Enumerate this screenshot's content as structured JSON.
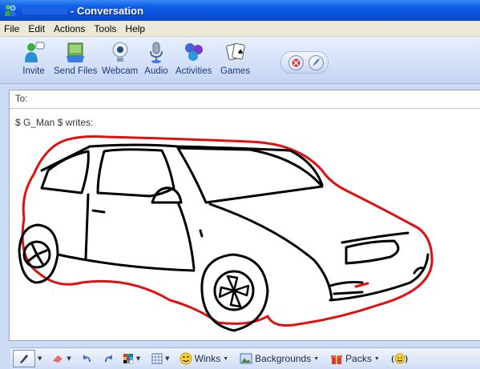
{
  "window": {
    "title": "- Conversation"
  },
  "menu": [
    "File",
    "Edit",
    "Actions",
    "Tools",
    "Help"
  ],
  "toolbar": {
    "items": [
      {
        "label": "Invite",
        "icon": "invite-icon"
      },
      {
        "label": "Send Files",
        "icon": "send-files-icon"
      },
      {
        "label": "Webcam",
        "icon": "webcam-icon"
      },
      {
        "label": "Audio",
        "icon": "microphone-icon"
      },
      {
        "label": "Activities",
        "icon": "activities-icon"
      },
      {
        "label": "Games",
        "icon": "games-icon"
      }
    ],
    "extra_buttons": [
      "block-icon",
      "feather-icon"
    ]
  },
  "conversation": {
    "to_label": "To:",
    "message_header": "$ G_Man $ writes:",
    "content": "handwritten drawing of a car"
  },
  "bottom_toolbar": {
    "winks": "Winks",
    "backgrounds": "Backgrounds",
    "packs": "Packs"
  },
  "colors": {
    "title_bar": "#0a48c8",
    "toolbar_bg": "#d2e0f8",
    "ink_black": "#000000",
    "ink_red": "#e01010"
  }
}
